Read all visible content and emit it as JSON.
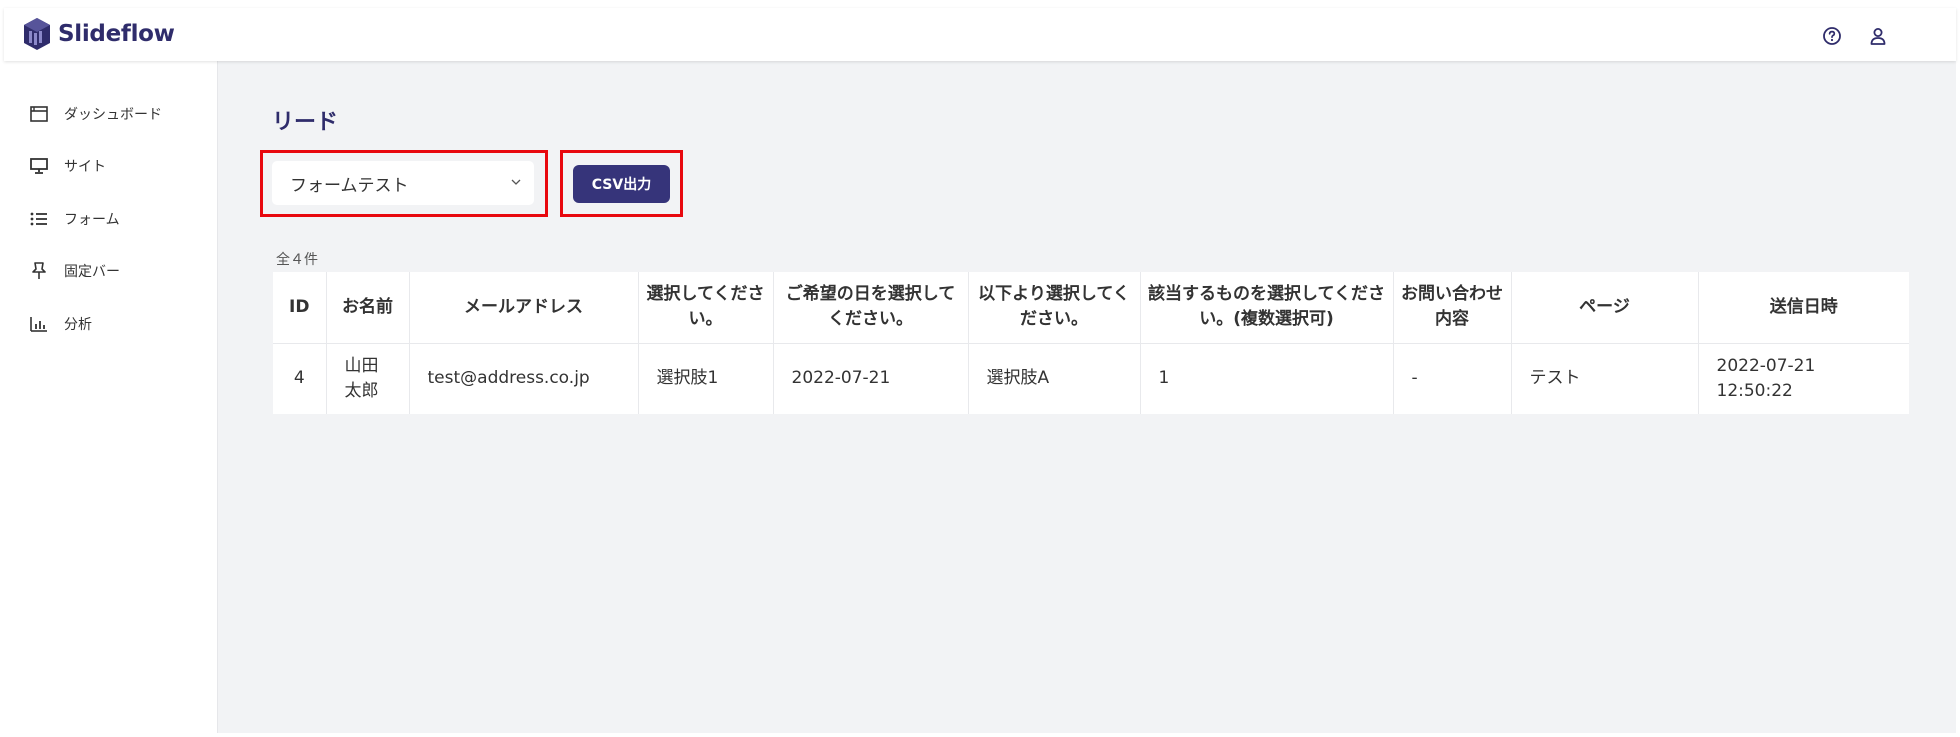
{
  "app": {
    "name": "Slideflow",
    "help_icon": "help-circle-icon",
    "user_icon": "user-icon"
  },
  "sidebar": {
    "items": [
      {
        "label": "ダッシュボード",
        "icon": "dashboard-window-icon"
      },
      {
        "label": "サイト",
        "icon": "monitor-icon"
      },
      {
        "label": "フォーム",
        "icon": "list-icon"
      },
      {
        "label": "固定バー",
        "icon": "pin-icon"
      },
      {
        "label": "分析",
        "icon": "bar-chart-icon"
      }
    ]
  },
  "main": {
    "title": "リード",
    "form_select": {
      "value": "フォームテスト",
      "icon": "chevron-down-icon"
    },
    "csv_button": "CSV出力",
    "count": "全４件"
  },
  "table": {
    "headers": [
      "ID",
      "お名前",
      "メールアドレス",
      "選択してください。",
      "ご希望の日を選択してください。",
      "以下より選択してください。",
      "該当するものを選択してください。(複数選択可)",
      "お問い合わせ内容",
      "ページ",
      "送信日時"
    ],
    "rows": [
      [
        "4",
        "山田太郎",
        "test@address.co.jp",
        "選択肢1",
        "2022-07-21",
        "選択肢A",
        "1",
        "-",
        "テスト",
        "2022-07-21 12:50:22"
      ]
    ]
  },
  "colors": {
    "brand": "#2f2c6b",
    "button": "#36347a",
    "highlight": "#e8080e",
    "background": "#f2f3f5"
  }
}
